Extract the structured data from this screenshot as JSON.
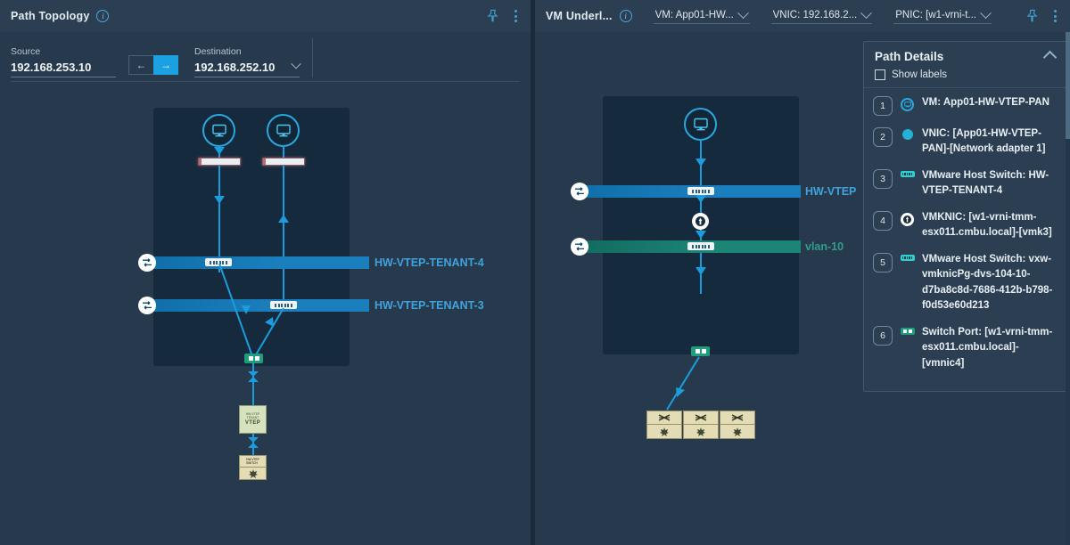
{
  "left_panel": {
    "header": {
      "title": "Path Topology",
      "info_icon": "info-icon",
      "pin_icon": "pin-icon",
      "menu_icon": "kebab-menu-icon"
    },
    "source": {
      "label": "Source",
      "value": "192.168.253.10"
    },
    "destination": {
      "label": "Destination",
      "value": "192.168.252.10"
    },
    "direction_toggle": {
      "left_label": "←",
      "right_label": "→",
      "active": "right"
    },
    "diagram": {
      "segments": [
        {
          "label": "HW-VTEP-TENANT-4",
          "color": "#1b7fbd",
          "type": "overlay"
        },
        {
          "label": "HW-VTEP-TENANT-3",
          "color": "#1b7fbd",
          "type": "overlay"
        }
      ],
      "vtep_node": {
        "caption_line1": "HW-VTEP",
        "caption_line2": "TENANT",
        "name": "VTEP"
      },
      "switch_node": {
        "caption_line1": "HW-VTEP",
        "caption_line2": "SWITCH"
      },
      "vm_icons": [
        "vm-icon",
        "vm-icon"
      ],
      "firewall_bars": 2
    }
  },
  "right_panel": {
    "header": {
      "title": "VM Underl...",
      "info_icon": "info-icon",
      "pin_icon": "pin-icon",
      "menu_icon": "kebab-menu-icon",
      "dropdowns": [
        {
          "name": "vm-selector",
          "value": "VM: App01-HW..."
        },
        {
          "name": "vnic-selector",
          "value": "VNIC: 192.168.2..."
        },
        {
          "name": "pnic-selector",
          "value": "PNIC: [w1-vrni-t..."
        }
      ]
    },
    "diagram": {
      "segments": [
        {
          "label": "HW-VTEP",
          "color": "#1b7fbd",
          "type": "overlay"
        },
        {
          "label": "vlan-10",
          "color": "#1b8576",
          "type": "vlan"
        }
      ],
      "switch_boxes": 3
    },
    "path_details": {
      "title": "Path Details",
      "collapse_icon": "chevron-up-icon",
      "show_labels": {
        "label": "Show labels",
        "checked": false
      },
      "steps": [
        {
          "num": "1",
          "icon": "vm-icon",
          "text": "VM: App01-HW-VTEP-PAN"
        },
        {
          "num": "2",
          "icon": "vnic-icon",
          "text": "VNIC: [App01-HW-VTEP-PAN]-[Network adapter 1]"
        },
        {
          "num": "3",
          "icon": "host-switch-icon",
          "text": "VMware Host Switch: HW-VTEP-TENANT-4"
        },
        {
          "num": "4",
          "icon": "vmknic-icon",
          "text": "VMKNIC: [w1-vrni-tmm-esx011.cmbu.local]-[vmk3]"
        },
        {
          "num": "5",
          "icon": "host-switch-icon",
          "text": "VMware Host Switch: vxw-vmknicPg-dvs-104-10-d7ba8c8d-7686-412b-b798-f0d53e60d213"
        },
        {
          "num": "6",
          "icon": "switch-port-icon",
          "text": "Switch Port: [w1-vrni-tmm-esx011.cmbu.local]-[vmnic4]"
        }
      ]
    }
  }
}
